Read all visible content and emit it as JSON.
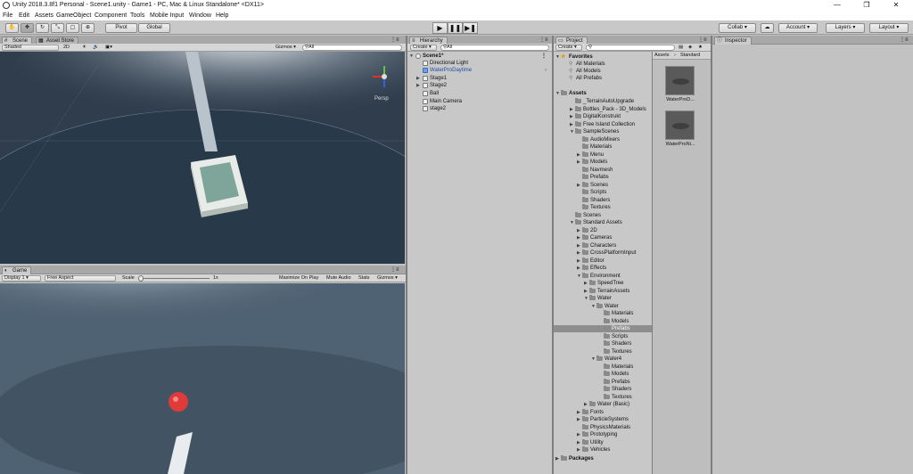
{
  "window": {
    "title": "Unity 2018.3.8f1 Personal - Scene1.unity - Game1 - PC, Mac & Linux Standalone* <DX11>",
    "minimize": "—",
    "restore": "❐",
    "close": "✕"
  },
  "menu": [
    "File",
    "Edit",
    "Assets",
    "GameObject",
    "Component",
    "Tools",
    "Mobile Input",
    "Window",
    "Help"
  ],
  "toolbar": {
    "pivot": "Pivot",
    "global": "Global",
    "collab": "Collab ▾",
    "account": "Account",
    "layers": "Layers",
    "layout": "Layout"
  },
  "scene_panel": {
    "tabs": [
      "Scene",
      "Asset Store"
    ],
    "shading": "Shaded",
    "mode_2d": "2D",
    "gizmos": "Gizmos ▾",
    "search_placeholder": "All",
    "persp": "Persp"
  },
  "game_panel": {
    "tab": "Game",
    "display": "Display 1",
    "aspect": "Free Aspect",
    "scale_label": "Scale",
    "scale_value": "1x",
    "maximize": "Maximize On Play",
    "mute": "Mute Audio",
    "stats": "Stats",
    "gizmos": "Gizmos ▾"
  },
  "hierarchy": {
    "tab": "Hierarchy",
    "create": "Create ▾",
    "search_placeholder": "All",
    "scene": "Scene1*",
    "items": [
      "Directional Light",
      "WaterProDaytime",
      "Stage1",
      "Stage2",
      "Ball",
      "Main Camera",
      "stage2"
    ]
  },
  "project": {
    "tab": "Project",
    "create": "Create ▾",
    "favorites": "Favorites",
    "fav_items": [
      "All Materials",
      "All Models",
      "All Prefabs"
    ],
    "assets_label": "Assets",
    "tree": [
      "_TerrainAutoUpgrade",
      "Bottles_Pack - 3D_Models",
      "DigitalKonstrukt",
      "Free Island Collection",
      "SampleScenes",
      "AudioMixers",
      "Materials",
      "Menu",
      "Models",
      "Navmesh",
      "Prefabs",
      "Scenes",
      "Scripts",
      "Shaders",
      "Textures",
      "Scenes",
      "Standard Assets",
      "2D",
      "Cameras",
      "Characters",
      "CrossPlatformInput",
      "Editor",
      "Effects",
      "Environment",
      "SpeedTree",
      "TerrainAssets",
      "Water",
      "Water",
      "Materials",
      "Models",
      "Prefabs",
      "Scripts",
      "Shaders",
      "Textures",
      "Water4",
      "Materials",
      "Models",
      "Prefabs",
      "Shaders",
      "Textures",
      "Water (Basic)",
      "Fonts",
      "ParticleSystems",
      "PhysicsMaterials",
      "Prototyping",
      "Utility",
      "Vehicles"
    ],
    "packages": "Packages",
    "breadcrumb": [
      "Assets",
      "Standard"
    ],
    "thumbs": [
      "WaterProD...",
      "WaterProNi..."
    ]
  },
  "inspector": {
    "tab": "Inspector"
  }
}
